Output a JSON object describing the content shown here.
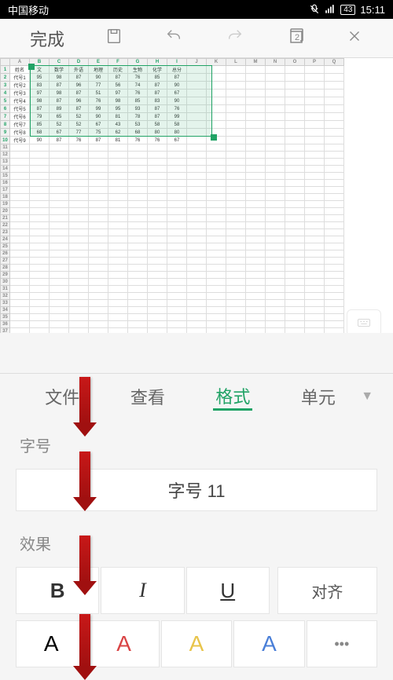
{
  "statusbar": {
    "carrier": "中国移动",
    "battery": "43",
    "time": "15:11"
  },
  "toolbar": {
    "done": "完成",
    "pages": "2"
  },
  "sheet": {
    "cols": [
      "A",
      "B",
      "C",
      "D",
      "E",
      "F",
      "G",
      "H",
      "I",
      "J",
      "K",
      "L",
      "M",
      "N",
      "O",
      "P",
      "Q"
    ],
    "rows": [
      "1",
      "2",
      "3",
      "4",
      "5",
      "6",
      "7",
      "8",
      "9",
      "10",
      "11",
      "12",
      "13",
      "14",
      "15",
      "16",
      "17",
      "18",
      "19",
      "20",
      "21",
      "22",
      "23",
      "24",
      "25",
      "26",
      "27",
      "28",
      "29",
      "30",
      "31",
      "32",
      "33",
      "34",
      "35",
      "36",
      "37"
    ],
    "headers": [
      "姓名",
      "文",
      "数学",
      "外语",
      "地理",
      "历史",
      "生物",
      "化学",
      "总分"
    ],
    "data": [
      [
        "代号1",
        "95",
        "98",
        "87",
        "90",
        "87",
        "76",
        "85",
        "87"
      ],
      [
        "代号2",
        "83",
        "87",
        "96",
        "77",
        "56",
        "74",
        "87",
        "90"
      ],
      [
        "代号3",
        "97",
        "98",
        "87",
        "51",
        "97",
        "76",
        "87",
        "67"
      ],
      [
        "代号4",
        "98",
        "87",
        "96",
        "76",
        "98",
        "85",
        "83",
        "90"
      ],
      [
        "代号5",
        "87",
        "89",
        "87",
        "99",
        "95",
        "93",
        "87",
        "76"
      ],
      [
        "代号6",
        "79",
        "65",
        "52",
        "90",
        "81",
        "78",
        "87",
        "99"
      ],
      [
        "代号7",
        "85",
        "52",
        "52",
        "67",
        "43",
        "53",
        "58",
        "58"
      ],
      [
        "代号8",
        "68",
        "67",
        "77",
        "75",
        "62",
        "68",
        "80",
        "80"
      ],
      [
        "代号9",
        "90",
        "87",
        "76",
        "87",
        "81",
        "76",
        "76",
        "67"
      ]
    ]
  },
  "tabs": {
    "file": "文件",
    "view": "查看",
    "format": "格式",
    "cell": "单元"
  },
  "format": {
    "fontsize_label": "字号",
    "fontsize_value": "字号 11",
    "effects_label": "效果",
    "bold": "B",
    "italic": "I",
    "underline": "U",
    "align": "对齐",
    "color_black": "A",
    "color_red": "A",
    "color_yellow": "A",
    "color_blue": "A",
    "more": "•••"
  }
}
